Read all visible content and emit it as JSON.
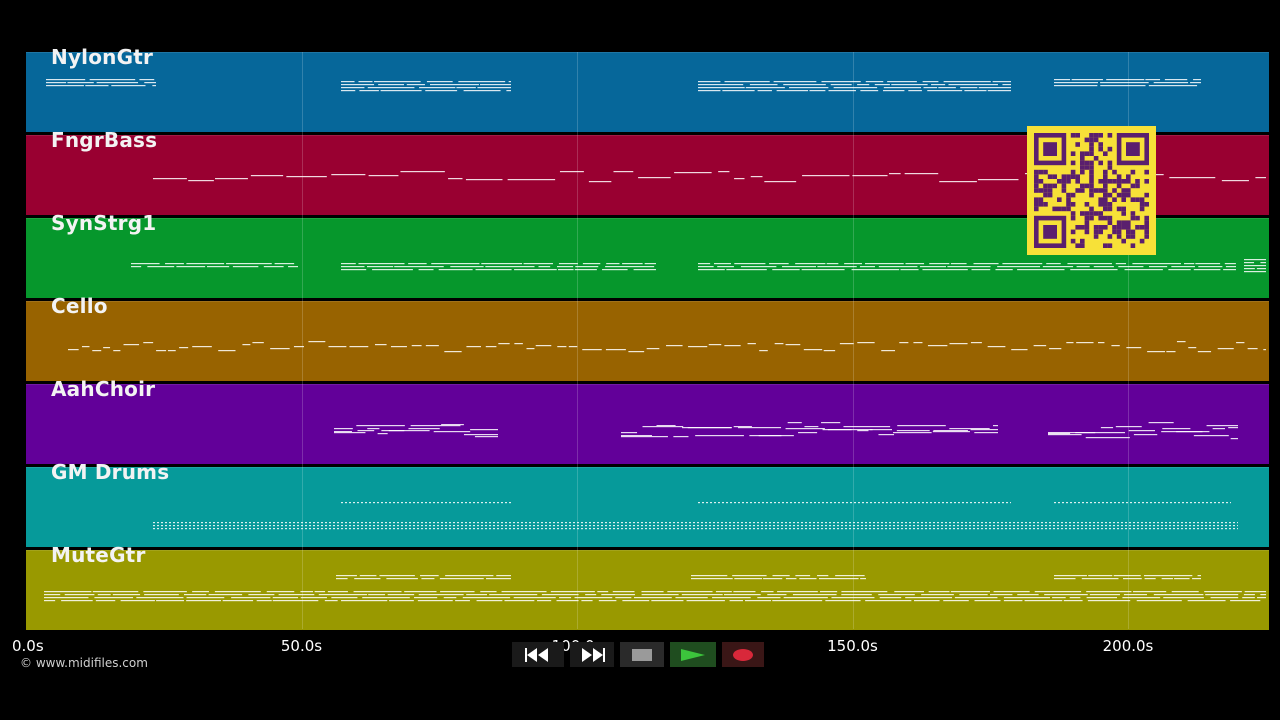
{
  "tracks": [
    {
      "name": "NylonGtr",
      "color": "#06679a",
      "pattern": "chords"
    },
    {
      "name": "FngrBass",
      "color": "#990031",
      "pattern": "bass"
    },
    {
      "name": "SynStrg1",
      "color": "#06972c",
      "pattern": "sustain"
    },
    {
      "name": "Cello",
      "color": "#986300",
      "pattern": "melody"
    },
    {
      "name": "AahChoir",
      "color": "#620099",
      "pattern": "choir"
    },
    {
      "name": "GM Drums",
      "color": "#069a9a",
      "pattern": "drums"
    },
    {
      "name": "MuteGtr",
      "color": "#999900",
      "pattern": "muted"
    }
  ],
  "timeline": {
    "ticks": [
      "0.0s",
      "50.0s",
      "100.0s",
      "150.0s",
      "200.0s"
    ],
    "tick_seconds": [
      0,
      50,
      100,
      150,
      200
    ],
    "total_seconds": 225.6
  },
  "transport": {
    "rewind": {
      "icon": "rewind-icon",
      "color": "#ffffff"
    },
    "fast_forward": {
      "icon": "fast-forward-icon",
      "color": "#ffffff"
    },
    "stop": {
      "icon": "stop-icon",
      "color": "#9a9a9a"
    },
    "play": {
      "icon": "play-icon",
      "color": "#3cc43c"
    },
    "record": {
      "icon": "record-icon",
      "color": "#d8283a"
    }
  },
  "qr_code": {
    "color": "#f7e138",
    "module_color": "#5a1f6e"
  },
  "copyright": "© www.midifiles.com"
}
